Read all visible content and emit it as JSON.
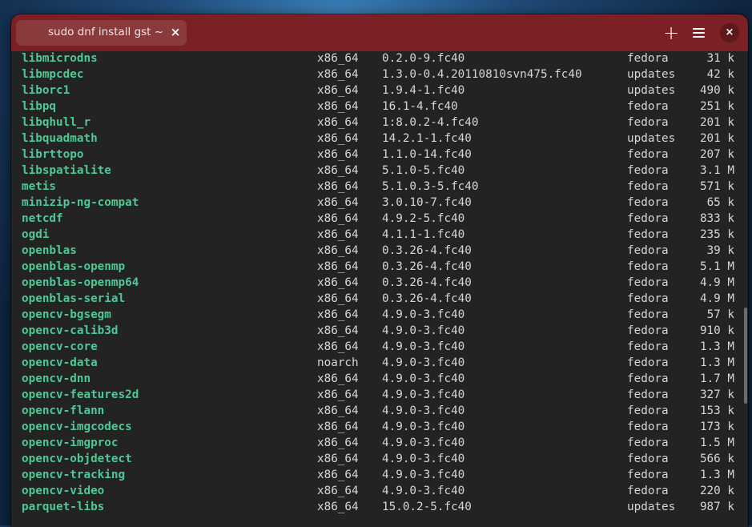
{
  "tab": {
    "title": "sudo dnf install gst ~",
    "close_label": "×"
  },
  "headerbar": {
    "new_tab_label": "+",
    "close_label": "×"
  },
  "terminal": {
    "rows": [
      {
        "name": "libmicrodns",
        "arch": "x86_64",
        "version": "0.2.0-9.fc40",
        "repo": "fedora",
        "size": "31 k"
      },
      {
        "name": "libmpcdec",
        "arch": "x86_64",
        "version": "1.3.0-0.4.20110810svn475.fc40",
        "repo": "updates",
        "size": "42 k"
      },
      {
        "name": "liborc1",
        "arch": "x86_64",
        "version": "1.9.4-1.fc40",
        "repo": "updates",
        "size": "490 k"
      },
      {
        "name": "libpq",
        "arch": "x86_64",
        "version": "16.1-4.fc40",
        "repo": "fedora",
        "size": "251 k"
      },
      {
        "name": "libqhull_r",
        "arch": "x86_64",
        "version": "1:8.0.2-4.fc40",
        "repo": "fedora",
        "size": "201 k"
      },
      {
        "name": "libquadmath",
        "arch": "x86_64",
        "version": "14.2.1-1.fc40",
        "repo": "updates",
        "size": "201 k"
      },
      {
        "name": "librttopo",
        "arch": "x86_64",
        "version": "1.1.0-14.fc40",
        "repo": "fedora",
        "size": "207 k"
      },
      {
        "name": "libspatialite",
        "arch": "x86_64",
        "version": "5.1.0-5.fc40",
        "repo": "fedora",
        "size": "3.1 M"
      },
      {
        "name": "metis",
        "arch": "x86_64",
        "version": "5.1.0.3-5.fc40",
        "repo": "fedora",
        "size": "571 k"
      },
      {
        "name": "minizip-ng-compat",
        "arch": "x86_64",
        "version": "3.0.10-7.fc40",
        "repo": "fedora",
        "size": "65 k"
      },
      {
        "name": "netcdf",
        "arch": "x86_64",
        "version": "4.9.2-5.fc40",
        "repo": "fedora",
        "size": "833 k"
      },
      {
        "name": "ogdi",
        "arch": "x86_64",
        "version": "4.1.1-1.fc40",
        "repo": "fedora",
        "size": "235 k"
      },
      {
        "name": "openblas",
        "arch": "x86_64",
        "version": "0.3.26-4.fc40",
        "repo": "fedora",
        "size": "39 k"
      },
      {
        "name": "openblas-openmp",
        "arch": "x86_64",
        "version": "0.3.26-4.fc40",
        "repo": "fedora",
        "size": "5.1 M"
      },
      {
        "name": "openblas-openmp64",
        "arch": "x86_64",
        "version": "0.3.26-4.fc40",
        "repo": "fedora",
        "size": "4.9 M"
      },
      {
        "name": "openblas-serial",
        "arch": "x86_64",
        "version": "0.3.26-4.fc40",
        "repo": "fedora",
        "size": "4.9 M"
      },
      {
        "name": "opencv-bgsegm",
        "arch": "x86_64",
        "version": "4.9.0-3.fc40",
        "repo": "fedora",
        "size": "57 k"
      },
      {
        "name": "opencv-calib3d",
        "arch": "x86_64",
        "version": "4.9.0-3.fc40",
        "repo": "fedora",
        "size": "910 k"
      },
      {
        "name": "opencv-core",
        "arch": "x86_64",
        "version": "4.9.0-3.fc40",
        "repo": "fedora",
        "size": "1.3 M"
      },
      {
        "name": "opencv-data",
        "arch": "noarch",
        "version": "4.9.0-3.fc40",
        "repo": "fedora",
        "size": "1.3 M"
      },
      {
        "name": "opencv-dnn",
        "arch": "x86_64",
        "version": "4.9.0-3.fc40",
        "repo": "fedora",
        "size": "1.7 M"
      },
      {
        "name": "opencv-features2d",
        "arch": "x86_64",
        "version": "4.9.0-3.fc40",
        "repo": "fedora",
        "size": "327 k"
      },
      {
        "name": "opencv-flann",
        "arch": "x86_64",
        "version": "4.9.0-3.fc40",
        "repo": "fedora",
        "size": "153 k"
      },
      {
        "name": "opencv-imgcodecs",
        "arch": "x86_64",
        "version": "4.9.0-3.fc40",
        "repo": "fedora",
        "size": "173 k"
      },
      {
        "name": "opencv-imgproc",
        "arch": "x86_64",
        "version": "4.9.0-3.fc40",
        "repo": "fedora",
        "size": "1.5 M"
      },
      {
        "name": "opencv-objdetect",
        "arch": "x86_64",
        "version": "4.9.0-3.fc40",
        "repo": "fedora",
        "size": "566 k"
      },
      {
        "name": "opencv-tracking",
        "arch": "x86_64",
        "version": "4.9.0-3.fc40",
        "repo": "fedora",
        "size": "1.3 M"
      },
      {
        "name": "opencv-video",
        "arch": "x86_64",
        "version": "4.9.0-3.fc40",
        "repo": "fedora",
        "size": "220 k"
      },
      {
        "name": "parquet-libs",
        "arch": "x86_64",
        "version": "15.0.2-5.fc40",
        "repo": "updates",
        "size": "987 k"
      }
    ]
  },
  "colors": {
    "headerbar": "#7b2024",
    "package_name": "#4ec995",
    "terminal_bg": "#232323",
    "terminal_text": "#d6d6d6"
  }
}
